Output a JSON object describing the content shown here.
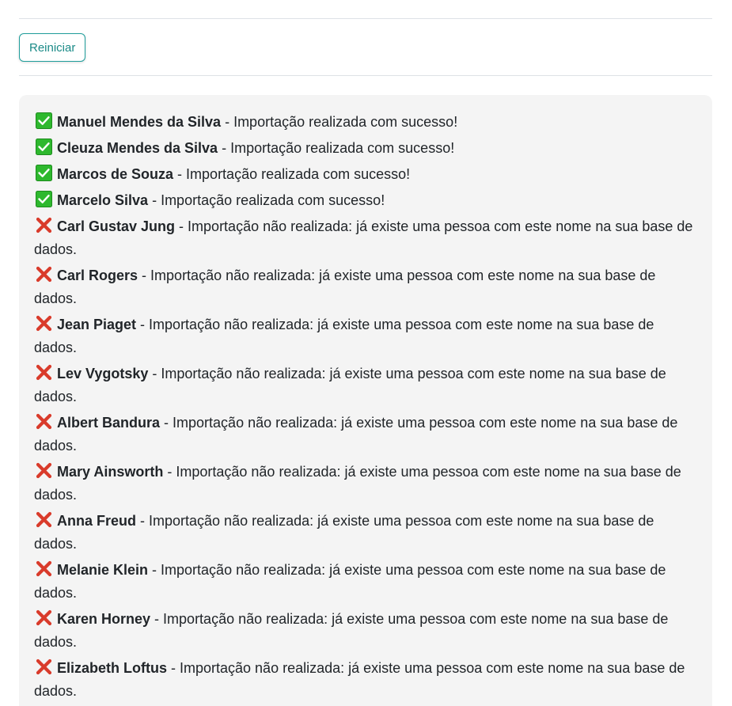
{
  "toolbar": {
    "restart_label": "Reiniciar"
  },
  "separator": " - ",
  "results": [
    {
      "status": "success",
      "name": "Manuel Mendes da Silva",
      "message": "Importação realizada com sucesso!"
    },
    {
      "status": "success",
      "name": "Cleuza Mendes da Silva",
      "message": "Importação realizada com sucesso!"
    },
    {
      "status": "success",
      "name": "Marcos de Souza",
      "message": "Importação realizada com sucesso!"
    },
    {
      "status": "success",
      "name": "Marcelo Silva",
      "message": "Importação realizada com sucesso!"
    },
    {
      "status": "error",
      "name": "Carl Gustav Jung",
      "message": "Importação não realizada: já existe uma pessoa com este nome na sua base de dados."
    },
    {
      "status": "error",
      "name": "Carl Rogers",
      "message": "Importação não realizada: já existe uma pessoa com este nome na sua base de dados."
    },
    {
      "status": "error",
      "name": "Jean Piaget",
      "message": "Importação não realizada: já existe uma pessoa com este nome na sua base de dados."
    },
    {
      "status": "error",
      "name": "Lev Vygotsky",
      "message": "Importação não realizada: já existe uma pessoa com este nome na sua base de dados."
    },
    {
      "status": "error",
      "name": "Albert Bandura",
      "message": "Importação não realizada: já existe uma pessoa com este nome na sua base de dados."
    },
    {
      "status": "error",
      "name": "Mary Ainsworth",
      "message": "Importação não realizada: já existe uma pessoa com este nome na sua base de dados."
    },
    {
      "status": "error",
      "name": "Anna Freud",
      "message": "Importação não realizada: já existe uma pessoa com este nome na sua base de dados."
    },
    {
      "status": "error",
      "name": "Melanie Klein",
      "message": "Importação não realizada: já existe uma pessoa com este nome na sua base de dados."
    },
    {
      "status": "error",
      "name": "Karen Horney",
      "message": "Importação não realizada: já existe uma pessoa com este nome na sua base de dados."
    },
    {
      "status": "error",
      "name": "Elizabeth Loftus",
      "message": "Importação não realizada: já existe uma pessoa com este nome na sua base de dados."
    }
  ],
  "colors": {
    "accent": "#1a8a87",
    "success_icon": "#2eb82e",
    "error_icon": "#d93b2b",
    "panel_bg": "#f4f4f4"
  },
  "icons": {
    "success": "check-mark-icon",
    "error": "cross-mark-icon"
  }
}
